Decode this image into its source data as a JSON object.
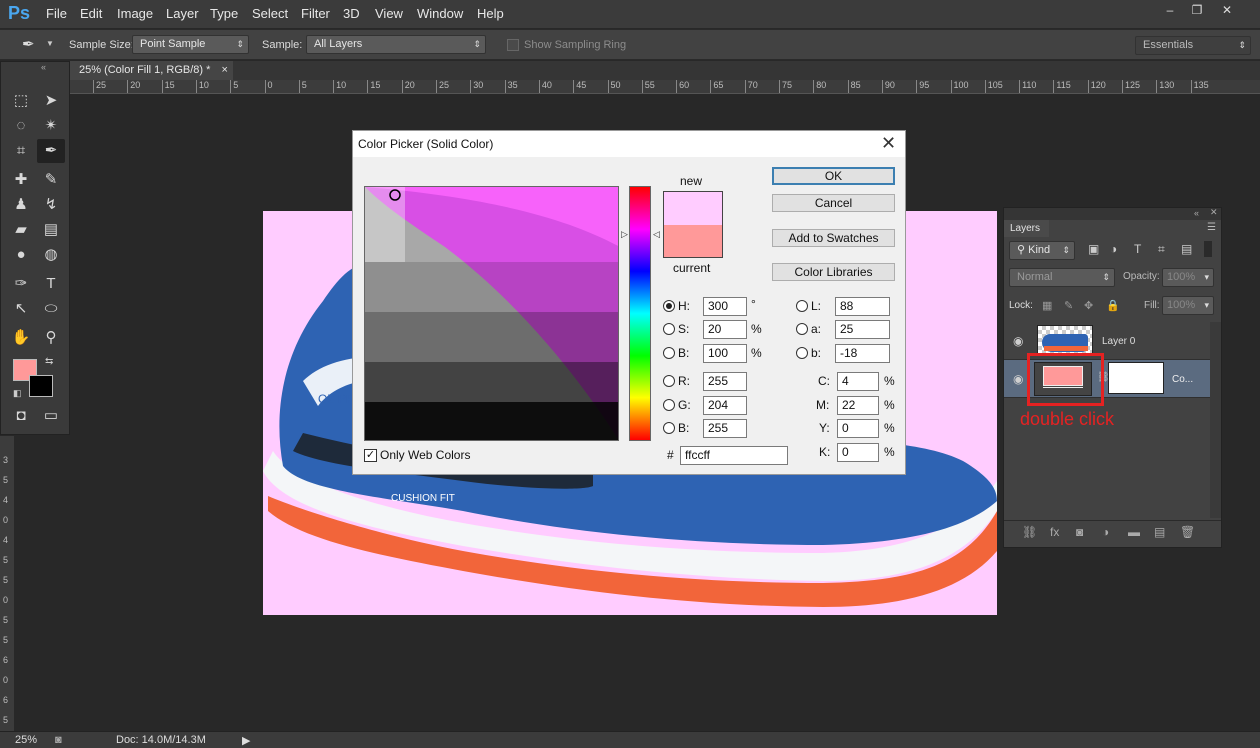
{
  "app": {
    "logo": "Ps"
  },
  "menu": [
    "File",
    "Edit",
    "Image",
    "Layer",
    "Type",
    "Select",
    "Filter",
    "3D",
    "View",
    "Window",
    "Help"
  ],
  "window_controls": [
    "–",
    "❐",
    "✕"
  ],
  "options_bar": {
    "sample_size_label": "Sample Size:",
    "sample_size_value": "Point Sample",
    "sample_label": "Sample:",
    "sample_value": "All Layers",
    "sampling_ring_label": "Show Sampling Ring",
    "workspace": "Essentials"
  },
  "document_tab": {
    "title": "25% (Color Fill 1, RGB/8) *",
    "close": "×"
  },
  "ruler_top": [
    "25",
    "20",
    "15",
    "10",
    "5",
    "0",
    "5",
    "10",
    "15",
    "20",
    "25",
    "30",
    "35",
    "40",
    "45",
    "50",
    "55",
    "60",
    "65",
    "70",
    "75",
    "80",
    "85",
    "90",
    "95",
    "100",
    "105",
    "110",
    "115",
    "120",
    "125",
    "130",
    "135"
  ],
  "ruler_left": [
    "3",
    "5",
    "4",
    "0",
    "4",
    "5",
    "5",
    "0",
    "5",
    "5",
    "6",
    "0",
    "6",
    "5"
  ],
  "status": {
    "zoom": "25%",
    "doc": "Doc: 14.0M/14.3M"
  },
  "canvas": {
    "bg_color": "#ffccff",
    "shoe_text_1": "OZ PR",
    "shoe_text_2": "CUSHION FIT"
  },
  "colors": {
    "foreground": "#ff9999",
    "background": "#000000",
    "new_color": "#ffccff",
    "current_color": "#ff9999",
    "annotation_red": "#e52222"
  },
  "color_picker": {
    "title": "Color Picker (Solid Color)",
    "close": "✕",
    "new_label": "new",
    "current_label": "current",
    "buttons": {
      "ok": "OK",
      "cancel": "Cancel",
      "add_swatches": "Add to Swatches",
      "libraries": "Color Libraries"
    },
    "hsb": {
      "h_label": "H:",
      "h": "300",
      "h_unit": "°",
      "s_label": "S:",
      "s": "20",
      "s_unit": "%",
      "b_label": "B:",
      "b": "100",
      "b_unit": "%"
    },
    "rgb": {
      "r_label": "R:",
      "r": "255",
      "g_label": "G:",
      "g": "204",
      "b_label": "B:",
      "b": "255"
    },
    "lab": {
      "l_label": "L:",
      "l": "88",
      "a_label": "a:",
      "a": "25",
      "b_label": "b:",
      "b": "-18"
    },
    "cmyk": {
      "c_label": "C:",
      "c": "4",
      "m_label": "M:",
      "m": "22",
      "y_label": "Y:",
      "y": "0",
      "k_label": "K:",
      "k": "0",
      "unit": "%"
    },
    "hex_label": "#",
    "hex": "ffccff",
    "only_web_label": "Only Web Colors",
    "only_web_checked": true
  },
  "layers_panel": {
    "tab": "Layers",
    "kind_filter": "Kind",
    "blend_mode": "Normal",
    "opacity_label": "Opacity:",
    "opacity": "100%",
    "lock_label": "Lock:",
    "fill_label": "Fill:",
    "fill": "100%",
    "layers": [
      {
        "name": "Layer 0"
      },
      {
        "name": "Co..."
      }
    ]
  },
  "annotation": {
    "text": "double click"
  }
}
